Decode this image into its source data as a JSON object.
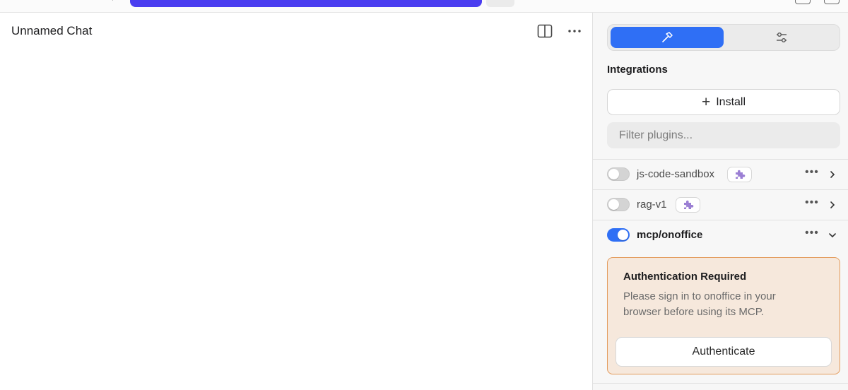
{
  "chat": {
    "title": "Unnamed Chat"
  },
  "panel": {
    "tabs": [
      {
        "icon": "hammer-icon",
        "active": true
      },
      {
        "icon": "sliders-icon",
        "active": false
      }
    ],
    "heading": "Integrations",
    "install_label": "Install",
    "filter_placeholder": "Filter plugins...",
    "plugins": [
      {
        "name": "js-code-sandbox",
        "enabled": false,
        "badge_icon": "puzzle-icon",
        "expanded": false
      },
      {
        "name": "rag-v1",
        "enabled": false,
        "badge_icon": "puzzle-icon",
        "expanded": false
      },
      {
        "name": "mcp/onoffice",
        "enabled": true,
        "expanded": true
      }
    ],
    "auth": {
      "title": "Authentication Required",
      "message": "Please sign in to onoffice in your browser before using its MCP.",
      "button_label": "Authenticate"
    }
  },
  "colors": {
    "accent": "#2f6ff5",
    "top_bar_pill": "#4a3df0",
    "auth_bg": "#f6e8dc",
    "auth_border": "#e39b5c",
    "badge_icon": "#9b7fd4"
  }
}
